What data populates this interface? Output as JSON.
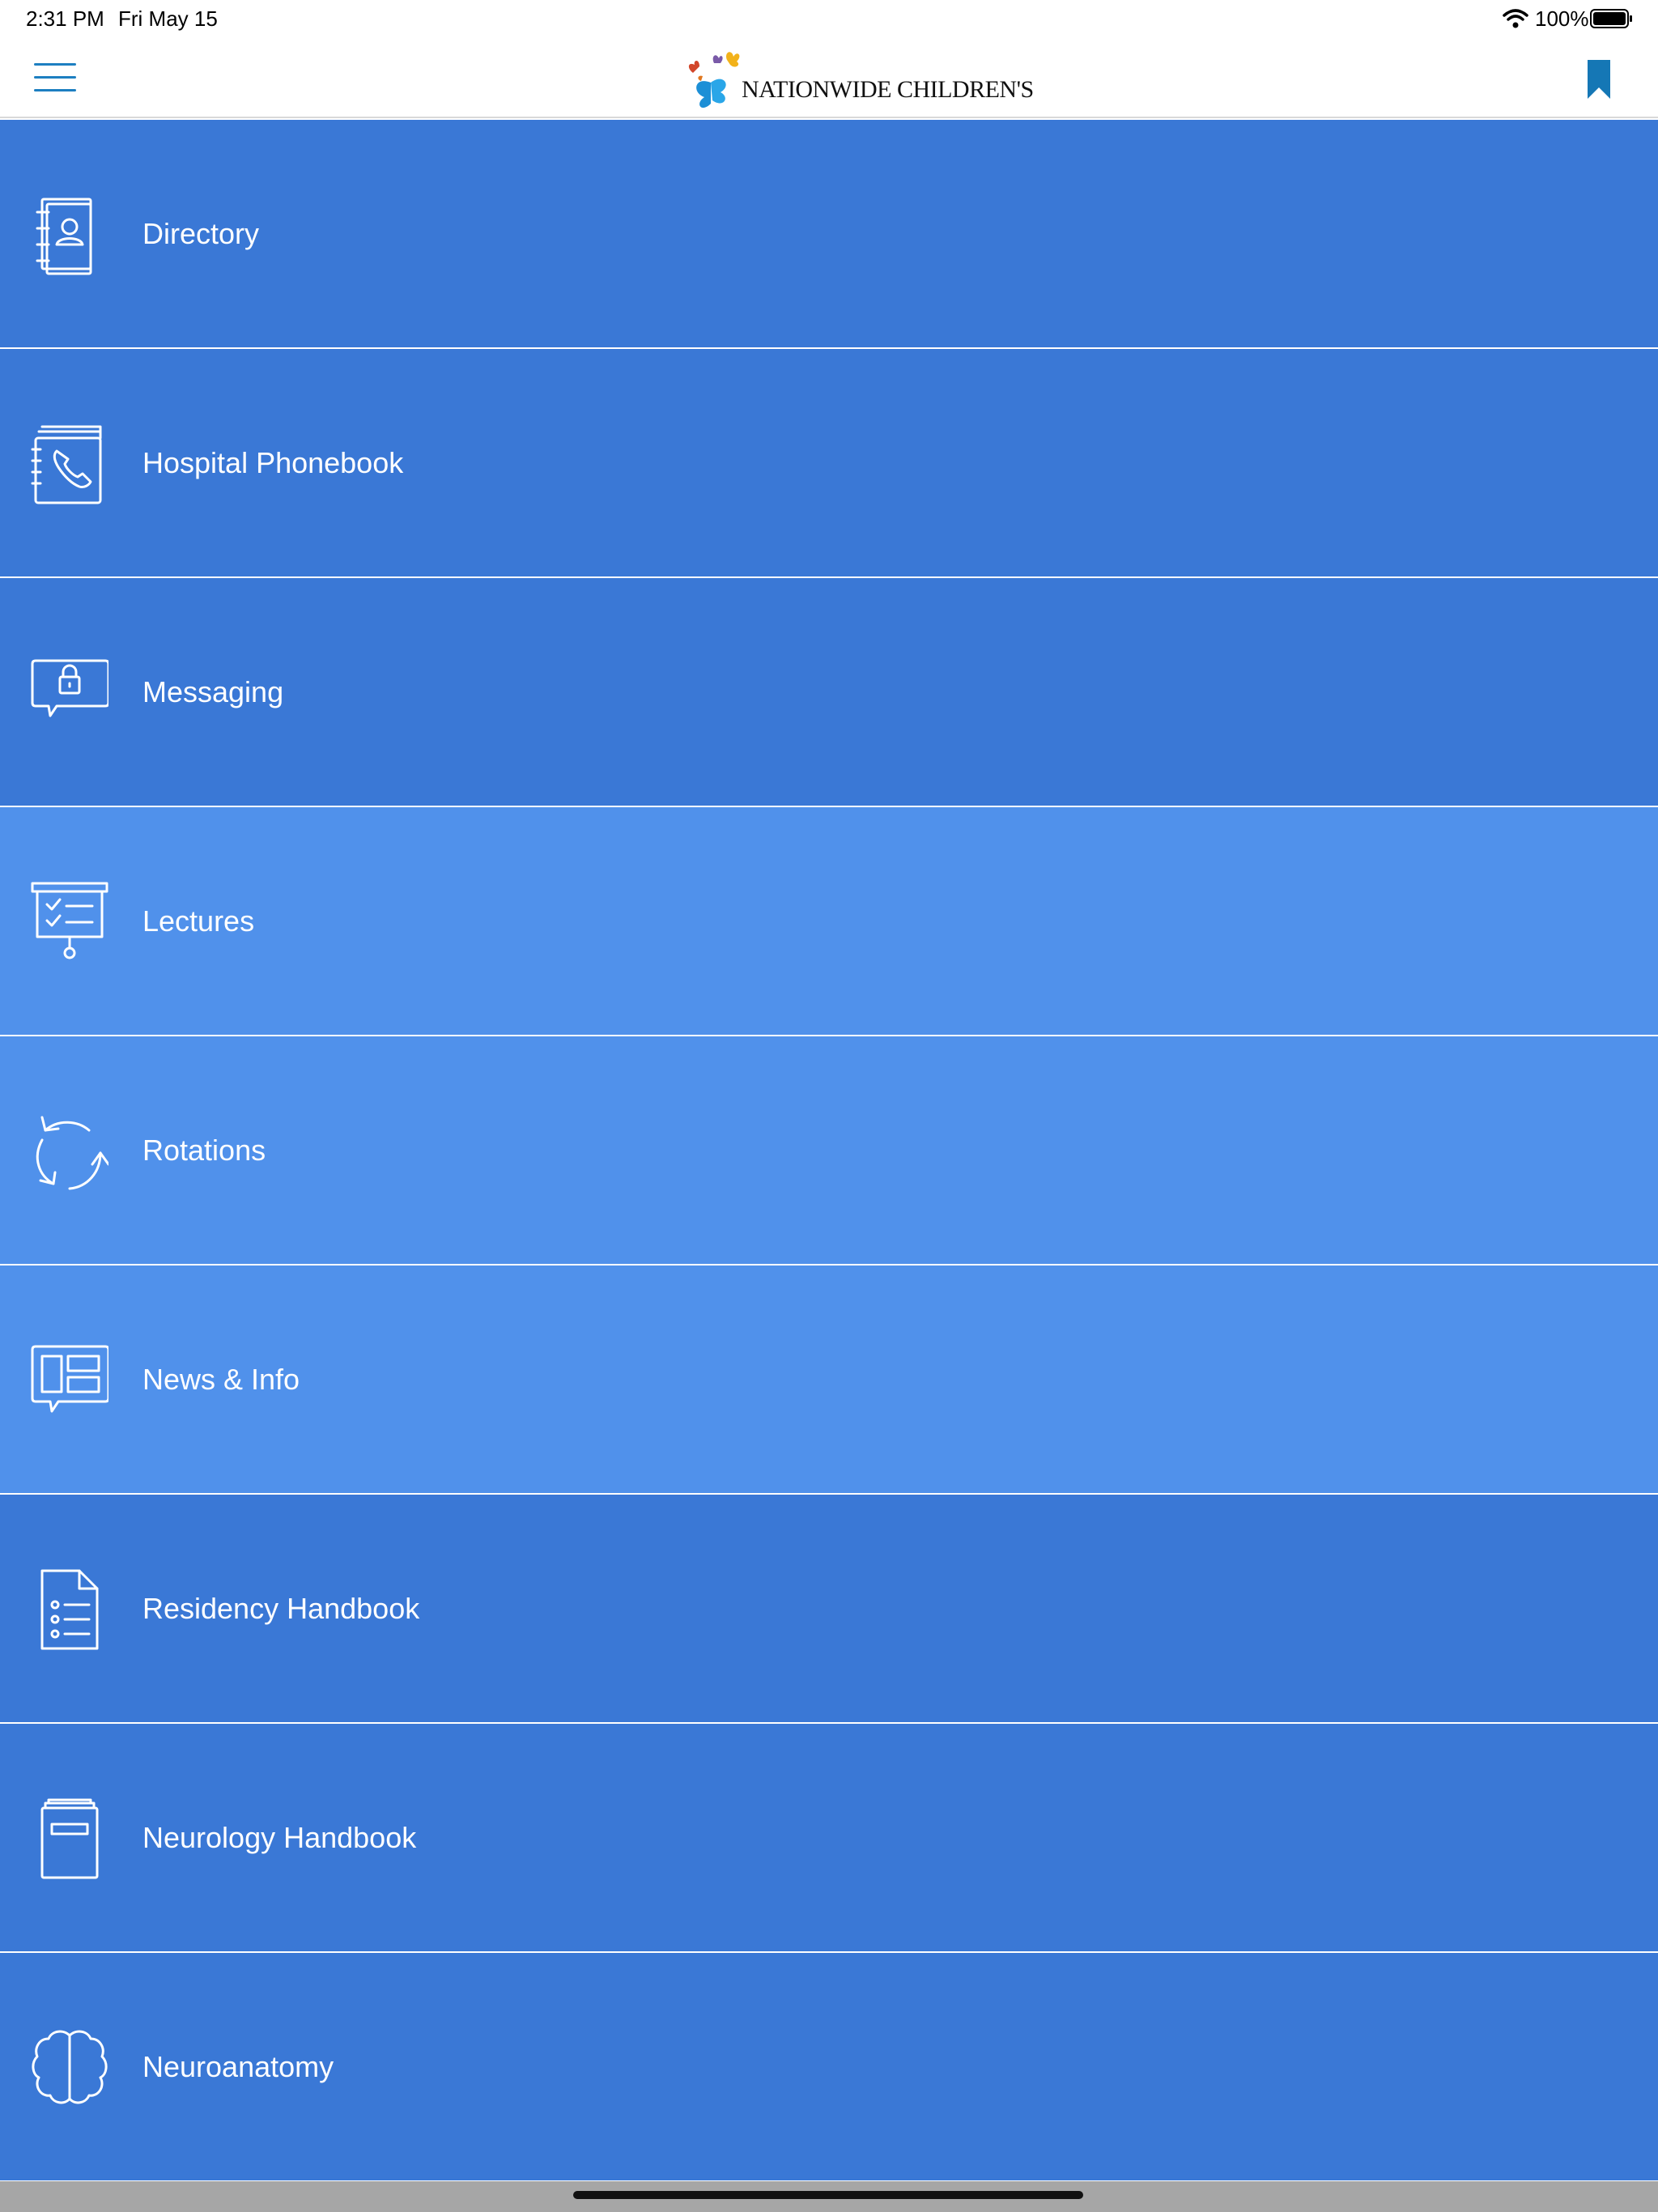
{
  "status_bar": {
    "time": "2:31 PM",
    "date": "Fri May 15",
    "battery": "100%"
  },
  "header": {
    "logo_text": "NATIONWIDE CHILDREN'S",
    "logo_icon": "butterflies-logo",
    "menu_icon": "hamburger-icon",
    "bookmark_icon": "bookmark-icon",
    "accent_color": "#1d7fc1"
  },
  "colors": {
    "dark_row": "#3a78d6",
    "light_row": "#5091eb",
    "row_text": "#ffffff"
  },
  "menu": {
    "items": [
      {
        "label": "Directory",
        "icon": "directory-contact-book-icon",
        "shade": "dark"
      },
      {
        "label": "Hospital Phonebook",
        "icon": "phonebook-icon",
        "shade": "dark"
      },
      {
        "label": "Messaging",
        "icon": "secure-message-icon",
        "shade": "dark"
      },
      {
        "label": "Lectures",
        "icon": "presentation-board-icon",
        "shade": "light"
      },
      {
        "label": "Rotations",
        "icon": "rotation-arrows-icon",
        "shade": "light"
      },
      {
        "label": "News & Info",
        "icon": "news-icon",
        "shade": "light"
      },
      {
        "label": "Residency Handbook",
        "icon": "document-list-icon",
        "shade": "dark"
      },
      {
        "label": "Neurology Handbook",
        "icon": "book-icon",
        "shade": "dark"
      },
      {
        "label": "Neuroanatomy",
        "icon": "brain-icon",
        "shade": "dark"
      }
    ]
  }
}
